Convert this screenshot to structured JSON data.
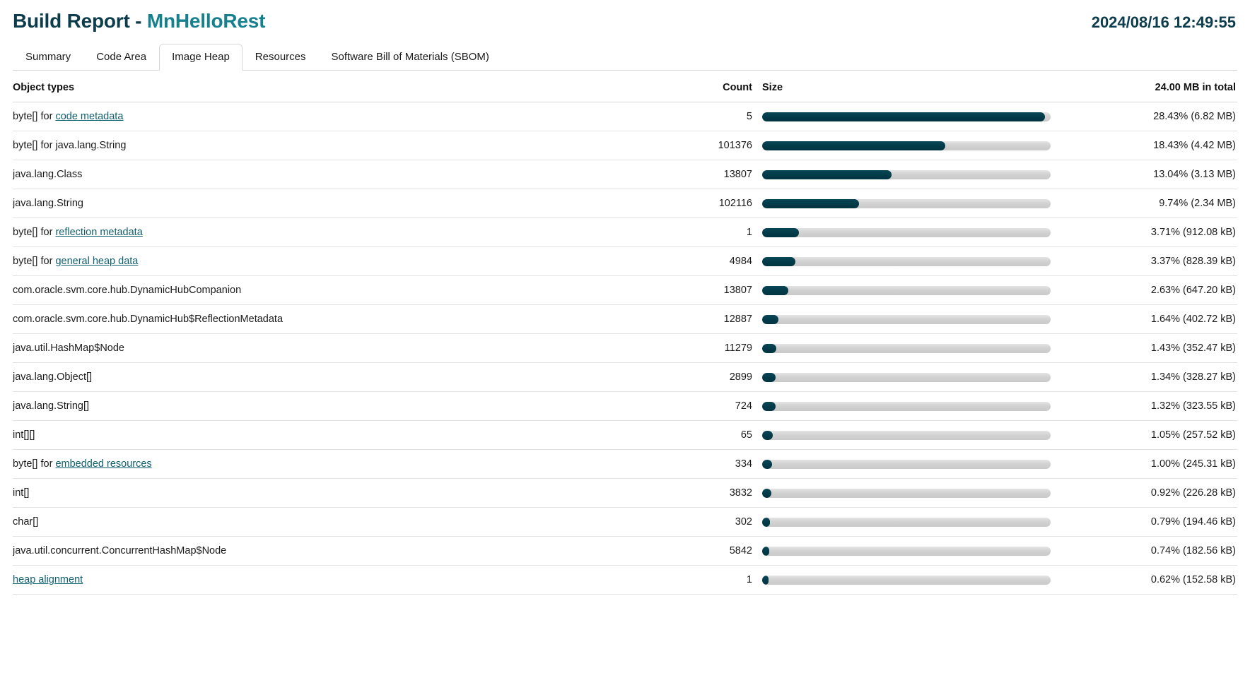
{
  "header": {
    "title_prefix": "Build Report - ",
    "project_name": "MnHelloRest",
    "timestamp": "2024/08/16 12:49:55"
  },
  "tabs": [
    {
      "label": "Summary",
      "active": false
    },
    {
      "label": "Code Area",
      "active": false
    },
    {
      "label": "Image Heap",
      "active": true
    },
    {
      "label": "Resources",
      "active": false
    },
    {
      "label": "Software Bill of Materials (SBOM)",
      "active": false
    }
  ],
  "table": {
    "columns": {
      "object_types": "Object types",
      "count": "Count",
      "size": "Size",
      "total": "24.00 MB in total"
    },
    "rows": [
      {
        "type_prefix": "byte[] for ",
        "type_link": "code metadata",
        "type_suffix": "",
        "count": "5",
        "percent": 28.43,
        "size_label": "28.43% (6.82 MB)"
      },
      {
        "type_prefix": "byte[] for java.lang.String",
        "type_link": "",
        "type_suffix": "",
        "count": "101376",
        "percent": 18.43,
        "size_label": "18.43% (4.42 MB)"
      },
      {
        "type_prefix": "java.lang.Class",
        "type_link": "",
        "type_suffix": "",
        "count": "13807",
        "percent": 13.04,
        "size_label": "13.04% (3.13 MB)"
      },
      {
        "type_prefix": "java.lang.String",
        "type_link": "",
        "type_suffix": "",
        "count": "102116",
        "percent": 9.74,
        "size_label": "9.74% (2.34 MB)"
      },
      {
        "type_prefix": "byte[] for ",
        "type_link": "reflection metadata",
        "type_suffix": "",
        "count": "1",
        "percent": 3.71,
        "size_label": "3.71% (912.08 kB)"
      },
      {
        "type_prefix": "byte[] for ",
        "type_link": "general heap data",
        "type_suffix": "",
        "count": "4984",
        "percent": 3.37,
        "size_label": "3.37% (828.39 kB)"
      },
      {
        "type_prefix": "com.oracle.svm.core.hub.DynamicHubCompanion",
        "type_link": "",
        "type_suffix": "",
        "count": "13807",
        "percent": 2.63,
        "size_label": "2.63% (647.20 kB)"
      },
      {
        "type_prefix": "com.oracle.svm.core.hub.DynamicHub$ReflectionMetadata",
        "type_link": "",
        "type_suffix": "",
        "count": "12887",
        "percent": 1.64,
        "size_label": "1.64% (402.72 kB)"
      },
      {
        "type_prefix": "java.util.HashMap$Node",
        "type_link": "",
        "type_suffix": "",
        "count": "11279",
        "percent": 1.43,
        "size_label": "1.43% (352.47 kB)"
      },
      {
        "type_prefix": "java.lang.Object[]",
        "type_link": "",
        "type_suffix": "",
        "count": "2899",
        "percent": 1.34,
        "size_label": "1.34% (328.27 kB)"
      },
      {
        "type_prefix": "java.lang.String[]",
        "type_link": "",
        "type_suffix": "",
        "count": "724",
        "percent": 1.32,
        "size_label": "1.32% (323.55 kB)"
      },
      {
        "type_prefix": "int[][]",
        "type_link": "",
        "type_suffix": "",
        "count": "65",
        "percent": 1.05,
        "size_label": "1.05% (257.52 kB)"
      },
      {
        "type_prefix": "byte[] for ",
        "type_link": "embedded resources",
        "type_suffix": "",
        "count": "334",
        "percent": 1.0,
        "size_label": "1.00% (245.31 kB)"
      },
      {
        "type_prefix": "int[]",
        "type_link": "",
        "type_suffix": "",
        "count": "3832",
        "percent": 0.92,
        "size_label": "0.92% (226.28 kB)"
      },
      {
        "type_prefix": "char[]",
        "type_link": "",
        "type_suffix": "",
        "count": "302",
        "percent": 0.79,
        "size_label": "0.79% (194.46 kB)"
      },
      {
        "type_prefix": "java.util.concurrent.ConcurrentHashMap$Node",
        "type_link": "",
        "type_suffix": "",
        "count": "5842",
        "percent": 0.74,
        "size_label": "0.74% (182.56 kB)"
      },
      {
        "type_prefix": "",
        "type_link": "heap alignment",
        "type_suffix": "",
        "count": "1",
        "percent": 0.62,
        "size_label": "0.62% (152.58 kB)"
      }
    ]
  },
  "colors": {
    "title_dark": "#0d3d4c",
    "project_teal": "#17808f",
    "bar_fill": "#023a48",
    "bar_track": "#d2d2d2",
    "link": "#11606f"
  }
}
